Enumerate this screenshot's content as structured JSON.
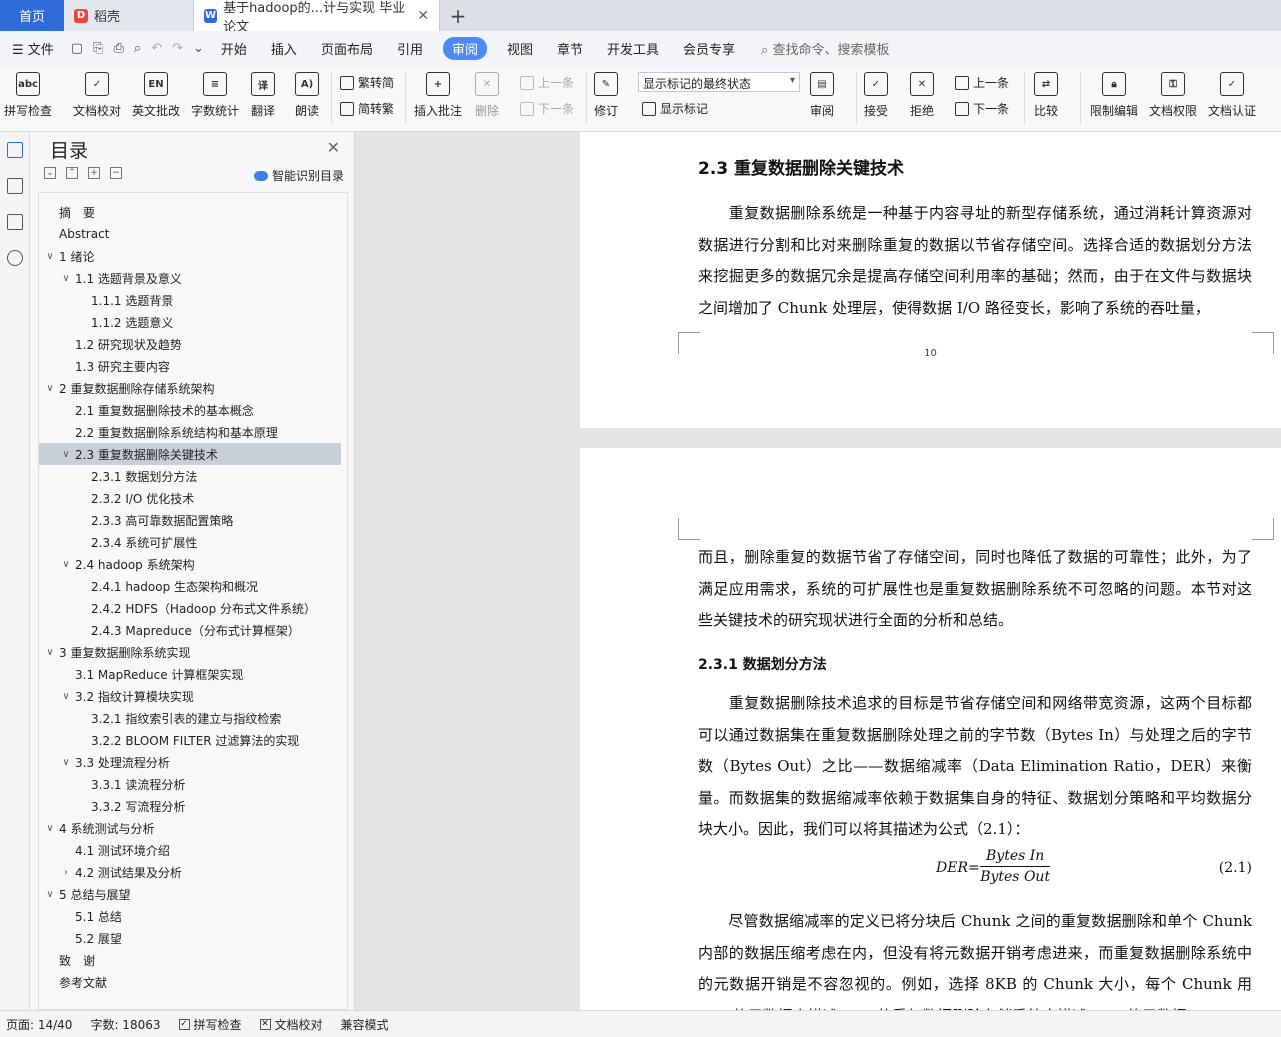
{
  "tabs": {
    "home": "首页",
    "daoke": "稻壳",
    "doc": "基于hadoop的...计与实现 毕业论文",
    "close": "✕",
    "add": "+"
  },
  "menu": {
    "file": "☰ 文件",
    "items": [
      "开始",
      "插入",
      "页面布局",
      "引用",
      "审阅",
      "视图",
      "章节",
      "开发工具",
      "会员专享"
    ],
    "search": "查找命令、搜索模板"
  },
  "ribbon": {
    "spell": "拼写检查",
    "doc_check": "文档校对",
    "en_review": "英文批改",
    "word_count": "字数统计",
    "translate": "翻译",
    "read": "朗读",
    "trad_simp": "繁转简",
    "simp_trad": "简转繁",
    "insert_comment": "插入批注",
    "delete": "删除",
    "prev": "上一条",
    "next": "下一条",
    "revise": "修订",
    "markup_state": "显示标记的最终状态",
    "show_markup": "显示标记",
    "review": "审阅",
    "accept": "接受",
    "reject": "拒绝",
    "prev2": "上一条",
    "next2": "下一条",
    "compare": "比较",
    "restrict": "限制编辑",
    "permission": "文档权限",
    "certify": "文档认证"
  },
  "toc": {
    "title": "目录",
    "smart": "智能识别目录",
    "items": [
      {
        "label": "摘　要",
        "level": 0,
        "arrow": ""
      },
      {
        "label": "Abstract",
        "level": 0,
        "arrow": ""
      },
      {
        "label": "1  绪论",
        "level": 0,
        "arrow": "∨"
      },
      {
        "label": "1.1 选题背景及意义",
        "level": 1,
        "arrow": "∨"
      },
      {
        "label": "1.1.1 选题背景",
        "level": 2,
        "arrow": ""
      },
      {
        "label": "1.1.2 选题意义",
        "level": 2,
        "arrow": ""
      },
      {
        "label": "1.2 研究现状及趋势",
        "level": 1,
        "arrow": ""
      },
      {
        "label": "1.3 研究主要内容",
        "level": 1,
        "arrow": ""
      },
      {
        "label": "2  重复数据删除存储系统架构",
        "level": 0,
        "arrow": "∨"
      },
      {
        "label": "2.1  重复数据删除技术的基本概念",
        "level": 1,
        "arrow": ""
      },
      {
        "label": "2.2  重复数据删除系统结构和基本原理",
        "level": 1,
        "arrow": ""
      },
      {
        "label": "2.3  重复数据删除关键技术",
        "level": 1,
        "arrow": "∨",
        "selected": true
      },
      {
        "label": "2.3.1  数据划分方法",
        "level": 2,
        "arrow": ""
      },
      {
        "label": "2.3.2 I/O 优化技术",
        "level": 2,
        "arrow": ""
      },
      {
        "label": "2.3.3  高可靠数据配置策略",
        "level": 2,
        "arrow": ""
      },
      {
        "label": "2.3.4  系统可扩展性",
        "level": 2,
        "arrow": ""
      },
      {
        "label": "2.4 hadoop 系统架构",
        "level": 1,
        "arrow": "∨"
      },
      {
        "label": "2.4.1 hadoop 生态架构和概况",
        "level": 2,
        "arrow": ""
      },
      {
        "label": "2.4.2 HDFS（Hadoop 分布式文件系统）",
        "level": 2,
        "arrow": ""
      },
      {
        "label": "2.4.3 Mapreduce（分布式计算框架）",
        "level": 2,
        "arrow": ""
      },
      {
        "label": "3  重复数据删除系统实现",
        "level": 0,
        "arrow": "∨"
      },
      {
        "label": "3.1 MapReduce 计算框架实现",
        "level": 1,
        "arrow": ""
      },
      {
        "label": "3.2 指纹计算模块实现",
        "level": 1,
        "arrow": "∨"
      },
      {
        "label": "3.2.1  指纹索引表的建立与指纹检索",
        "level": 2,
        "arrow": ""
      },
      {
        "label": "3.2.2 BLOOM FILTER 过滤算法的实现",
        "level": 2,
        "arrow": ""
      },
      {
        "label": "3.3 处理流程分析",
        "level": 1,
        "arrow": "∨"
      },
      {
        "label": "3.3.1 读流程分析",
        "level": 2,
        "arrow": ""
      },
      {
        "label": "3.3.2  写流程分析",
        "level": 2,
        "arrow": ""
      },
      {
        "label": "4 系统测试与分析",
        "level": 0,
        "arrow": "∨"
      },
      {
        "label": "4.1  测试环境介绍",
        "level": 1,
        "arrow": ""
      },
      {
        "label": "4.2  测试结果及分析",
        "level": 1,
        "arrow": "›"
      },
      {
        "label": "5  总结与展望",
        "level": 0,
        "arrow": "∨"
      },
      {
        "label": "5.1  总结",
        "level": 1,
        "arrow": ""
      },
      {
        "label": "5.2  展望",
        "level": 1,
        "arrow": ""
      },
      {
        "label": "致　谢",
        "level": 0,
        "arrow": ""
      },
      {
        "label": "参考文献",
        "level": 0,
        "arrow": ""
      }
    ]
  },
  "doc": {
    "heading_2_3": "2.3  重复数据删除关键技术",
    "para1": "　　重复数据删除系统是一种基于内容寻址的新型存储系统，通过消耗计算资源对数据进行分割和比对来删除重复的数据以节省存储空间。选择合适的数据划分方法来挖掘更多的数据冗余是提高存储空间利用率的基础；然而，由于在文件与数据块之间增加了 Chunk 处理层，使得数据 I/O 路径变长，影响了系统的吞吐量，",
    "page_number": "10",
    "para2": "而且，删除重复的数据节省了存储空间，同时也降低了数据的可靠性；此外，为了满足应用需求，系统的可扩展性也是重复数据删除系统不可忽略的问题。本节对这些关键技术的研究现状进行全面的分析和总结。",
    "heading_2_3_1": "2.3.1  数据划分方法",
    "para3": "　　重复数据删除技术追求的目标是节省存储空间和网络带宽资源，这两个目标都可以通过数据集在重复数据删除处理之前的字节数（Bytes In）与处理之后的字节数（Bytes Out）之比——数据缩减率（Data Elimination Ratio，DER）来衡量。而数据集的数据缩减率依赖于数据集自身的特征、数据划分策略和平均数据分块大小。因此，我们可以将其描述为公式（2.1）：",
    "formula_lhs": "DER=",
    "formula_num": "Bytes In",
    "formula_den": "Bytes Out",
    "formula_no": "(2.1)",
    "para4": "　　尽管数据缩减率的定义已将分块后 Chunk 之间的重复数据删除和单个 Chunk 内部的数据压缩考虑在内，但没有将元数据开销考虑进来，而重复数据删除系统中的元数据开销是不容忽视的。例如，选择 8KB 的 Chunk 大小，每个 Chunk 用 …… 的元数据来描述 …… 的重复数据删除存储系统中描述 …… 的元数据"
  },
  "status": {
    "page": "页面: 14/40",
    "words": "字数: 18063",
    "spell": "拼写检查",
    "check": "文档校对",
    "compat": "兼容模式"
  }
}
